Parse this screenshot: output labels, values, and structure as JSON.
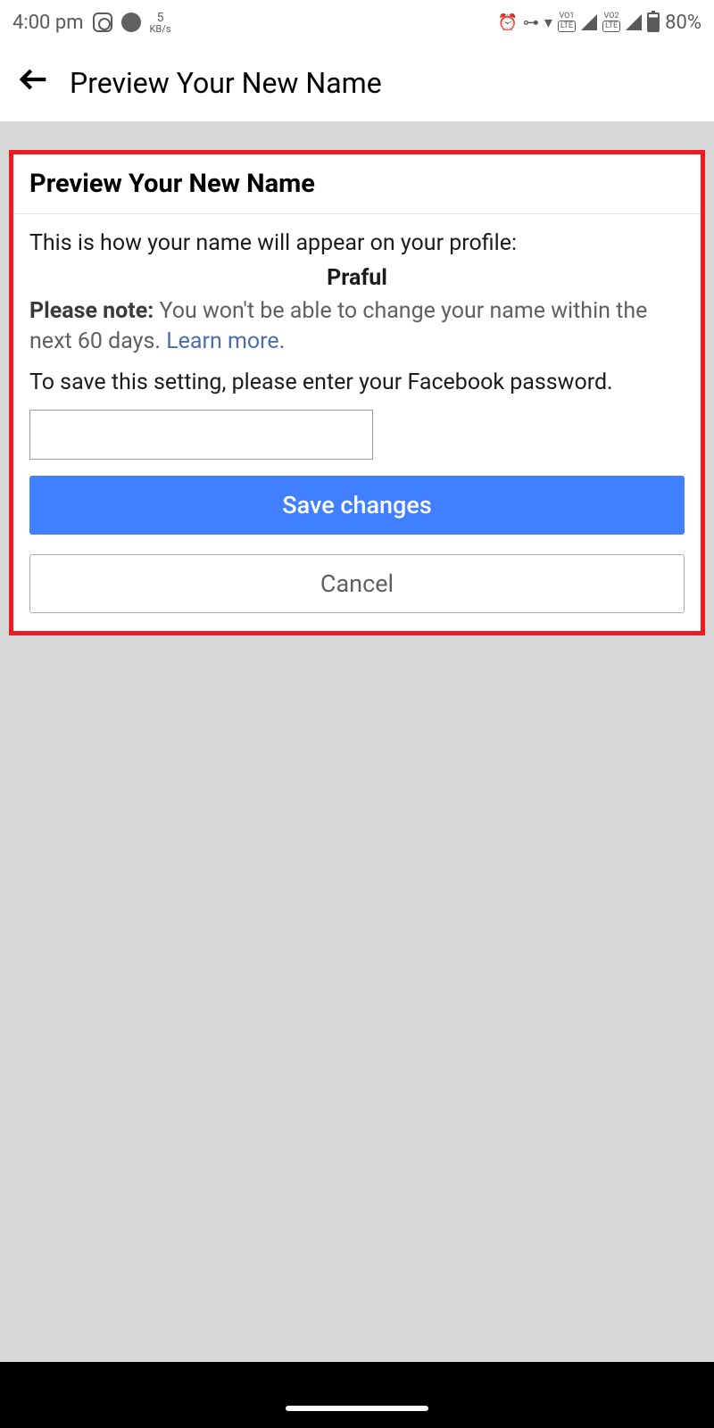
{
  "statusBar": {
    "time": "4:00 pm",
    "speedNum": "5",
    "speedUnit": "KB/s",
    "batteryPct": "80%",
    "vo1": "VO1",
    "vo2": "VO2",
    "lte": "LTE"
  },
  "header": {
    "title": "Preview Your New Name"
  },
  "card": {
    "title": "Preview Your New Name",
    "introText": "This is how your name will appear on your profile:",
    "namePreview": "Praful",
    "noteLabel": "Please note:",
    "noteText": " You won't be able to change your name within the next 60 days. ",
    "learnMore": "Learn more",
    "period": ".",
    "saveInstruction": "To save this setting, please enter your Facebook password.",
    "saveButton": "Save changes",
    "cancelButton": "Cancel"
  }
}
